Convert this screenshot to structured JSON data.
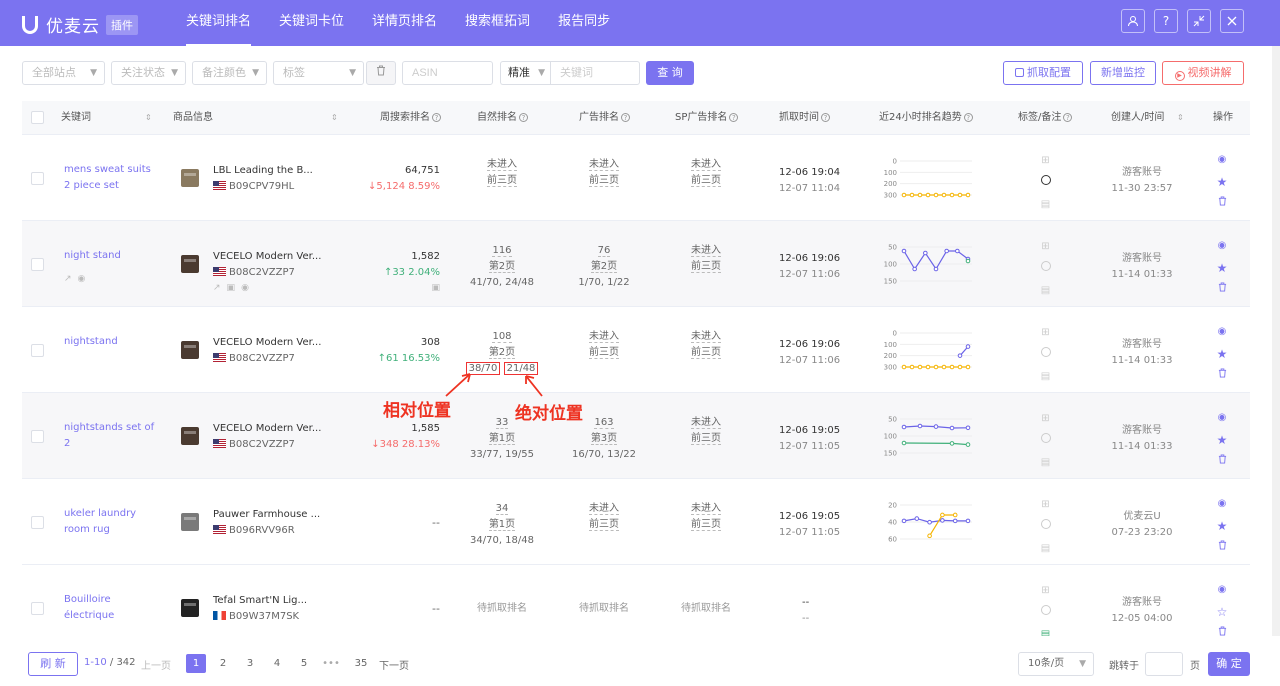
{
  "app": {
    "name": "优麦云",
    "badge": "插件"
  },
  "nav": [
    {
      "label": "关键词排名",
      "active": true
    },
    {
      "label": "关键词卡位"
    },
    {
      "label": "详情页排名"
    },
    {
      "label": "搜索框拓词"
    },
    {
      "label": "报告同步"
    }
  ],
  "top_icons": [
    "user-icon",
    "help-icon",
    "shrink-icon",
    "close-icon"
  ],
  "filters": {
    "site": "全部站点",
    "status": "关注状态",
    "color": "备注颜色",
    "tag": "标签",
    "asin_placeholder": "ASIN",
    "match": "精准",
    "keyword_placeholder": "关键词",
    "search_label": "查 询",
    "crawl_config_label": "抓取配置",
    "add_monitor_label": "新增监控",
    "video_label": "视频讲解"
  },
  "columns": {
    "keyword": "关键词",
    "product": "商品信息",
    "weekly": "周搜索排名",
    "organic": "自然排名",
    "ad": "广告排名",
    "sp": "SP广告排名",
    "crawl": "抓取时间",
    "trend": "近24小时排名趋势",
    "tag": "标签/备注",
    "creator": "创建人/时间",
    "ops": "操作"
  },
  "rows": [
    {
      "keyword": "mens sweat suits 2 piece set",
      "product_title": "LBL Leading the B...",
      "asin": "B09CPV79HL",
      "flag": "us",
      "weekly_rank": "64,751",
      "weekly_change": "↓5,124  8.59%",
      "weekly_dir": "down",
      "organic": [
        "未进入",
        "前三页",
        ""
      ],
      "ad": [
        "未进入",
        "前三页",
        ""
      ],
      "sp": [
        "未进入",
        "前三页",
        ""
      ],
      "crawl": [
        "12-06 19:04",
        "12-07 11:04"
      ],
      "trend": {
        "labels": [
          "0",
          "100",
          "200",
          "300"
        ],
        "series": [
          {
            "color": "#f5b400",
            "values": [
              300,
              300,
              300,
              300,
              300,
              300,
              300,
              300,
              300
            ]
          }
        ],
        "ymin": 0,
        "ymax": 300
      },
      "creator": [
        "游客账号",
        "11-30 23:57"
      ],
      "starred": true,
      "circle_dark": true
    },
    {
      "keyword": "night stand",
      "product_title": "VECELO Modern Ver...",
      "asin": "B08C2VZZP7",
      "flag": "us",
      "weekly_rank": "1,582",
      "weekly_change": "↑33  2.04%",
      "weekly_dir": "up",
      "organic": [
        "116",
        "第2页",
        "41/70, 24/48"
      ],
      "ad": [
        "76",
        "第2页",
        "1/70, 1/22"
      ],
      "sp": [
        "未进入",
        "前三页",
        ""
      ],
      "crawl": [
        "12-06 19:06",
        "12-07 11:06"
      ],
      "trend": {
        "labels": [
          "50",
          "100",
          "150"
        ],
        "series": [
          {
            "color": "#6b63e8",
            "values": [
              20,
              110,
              30,
              110,
              20,
              20,
              60
            ]
          },
          {
            "color": "#40b07a",
            "values": [
              null,
              null,
              null,
              null,
              null,
              null,
              70
            ]
          }
        ],
        "ymin": 0,
        "ymax": 170
      },
      "creator": [
        "游客账号",
        "11-14 01:33"
      ],
      "starred": true,
      "alt": true
    },
    {
      "keyword": "nightstand",
      "product_title": "VECELO Modern Ver...",
      "asin": "B08C2VZZP7",
      "flag": "us",
      "weekly_rank": "308",
      "weekly_change": "↑61  16.53%",
      "weekly_dir": "up",
      "organic": [
        "108",
        "第2页",
        "38/70",
        "21/48"
      ],
      "ad": [
        "未进入",
        "前三页",
        ""
      ],
      "sp": [
        "未进入",
        "前三页",
        ""
      ],
      "crawl": [
        "12-06 19:06",
        "12-07 11:06"
      ],
      "trend": {
        "labels": [
          "0",
          "100",
          "200",
          "300"
        ],
        "series": [
          {
            "color": "#f5b400",
            "values": [
              300,
              300,
              300,
              300,
              300,
              300,
              300,
              300,
              300
            ]
          },
          {
            "color": "#6b63e8",
            "values": [
              null,
              null,
              null,
              null,
              null,
              null,
              null,
              200,
              120
            ]
          }
        ],
        "ymin": 0,
        "ymax": 300
      },
      "creator": [
        "游客账号",
        "11-14 01:33"
      ],
      "starred": true
    },
    {
      "keyword": "nightstands set of 2",
      "product_title": "VECELO Modern Ver...",
      "asin": "B08C2VZZP7",
      "flag": "us",
      "weekly_rank": "1,585",
      "weekly_change": "↓348  28.13%",
      "weekly_dir": "down",
      "organic": [
        "33",
        "第1页",
        "33/77, 19/55"
      ],
      "ad": [
        "163",
        "第3页",
        "16/70, 13/22"
      ],
      "sp": [
        "未进入",
        "前三页",
        ""
      ],
      "crawl": [
        "12-06 19:05",
        "12-07 11:05"
      ],
      "trend": {
        "labels": [
          "50",
          "100",
          "150"
        ],
        "series": [
          {
            "color": "#6b63e8",
            "values": [
              40,
              35,
              38,
              45,
              44
            ]
          },
          {
            "color": "#40b07a",
            "values": [
              120,
              null,
              null,
              122,
              128
            ]
          }
        ],
        "ymin": 0,
        "ymax": 170
      },
      "creator": [
        "游客账号",
        "11-14 01:33"
      ],
      "starred": true,
      "alt": true
    },
    {
      "keyword": "ukeler laundry room rug",
      "product_title": "Pauwer Farmhouse ...",
      "asin": "B096RVV96R",
      "flag": "us",
      "weekly_rank": "--",
      "weekly_change": "",
      "weekly_dir": "",
      "organic": [
        "34",
        "第1页",
        "34/70, 18/48"
      ],
      "ad": [
        "未进入",
        "前三页",
        ""
      ],
      "sp": [
        "未进入",
        "前三页",
        ""
      ],
      "crawl": [
        "12-06 19:05",
        "12-07 11:05"
      ],
      "trend": {
        "labels": [
          "20",
          "40",
          "60"
        ],
        "series": [
          {
            "color": "#6b63e8",
            "values": [
              35,
              30,
              38,
              34,
              35,
              35
            ]
          },
          {
            "color": "#f5b400",
            "values": [
              null,
              null,
              68,
              22,
              22,
              null
            ]
          }
        ],
        "ymin": 0,
        "ymax": 75
      },
      "creator": [
        "优麦云U",
        "07-23 23:20"
      ],
      "starred": true
    },
    {
      "keyword": "Bouilloire électrique",
      "product_title": "Tefal Smart'N Lig...",
      "asin": "B09W37M7SK",
      "flag": "fr",
      "weekly_rank": "--",
      "weekly_change": "",
      "weekly_dir": "",
      "organic": [
        "待抓取排名"
      ],
      "ad": [
        "待抓取排名"
      ],
      "sp": [
        "待抓取排名"
      ],
      "crawl": [
        "--",
        "--"
      ],
      "trend": {
        "labels": [],
        "series": []
      },
      "creator": [
        "游客账号",
        "12-05 04:00"
      ],
      "starred": false,
      "note_green": true
    }
  ],
  "annotations": {
    "relative": "相对位置",
    "absolute": "绝对位置"
  },
  "pagination": {
    "refresh": "刷 新",
    "range": "1-10",
    "total": "/ 342",
    "prev": "上一页",
    "pages": [
      "1",
      "2",
      "3",
      "4",
      "5",
      "•••",
      "35"
    ],
    "next": "下一页",
    "page_size": "10条/页",
    "jump_label": "跳转于",
    "page_unit": "页",
    "confirm": "确 定"
  },
  "colors": {
    "accent": "#7b73f0",
    "down": "#f56c6c",
    "up": "#40b07a"
  }
}
